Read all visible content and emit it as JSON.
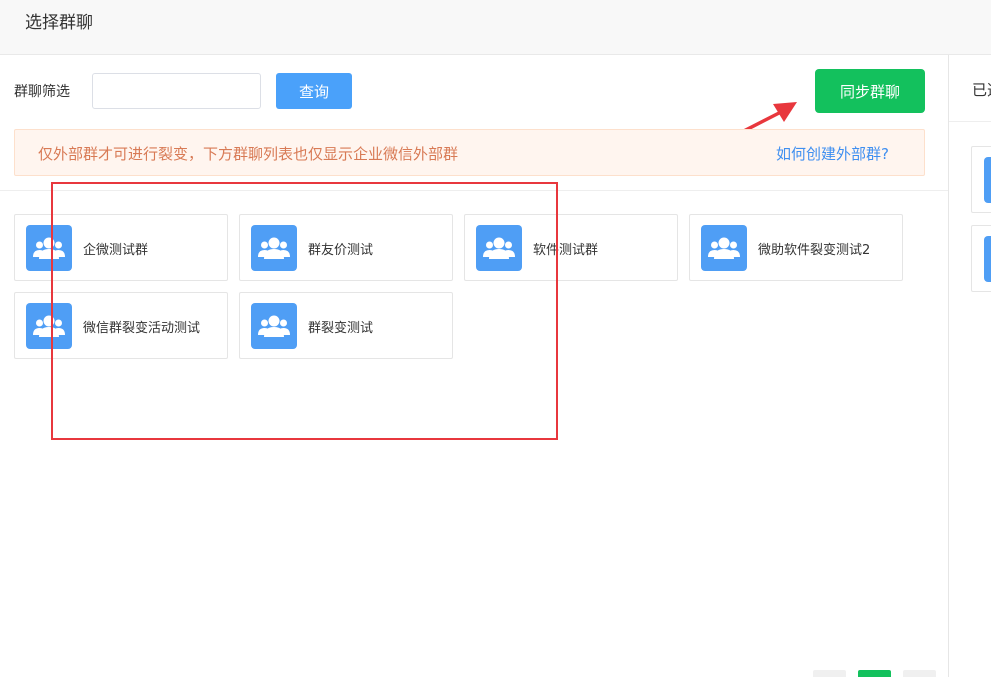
{
  "header": {
    "title": "选择群聊"
  },
  "filter": {
    "label": "群聊筛选",
    "input_value": "",
    "input_placeholder": "",
    "query_label": "查询",
    "sync_label": "同步群聊"
  },
  "notice": {
    "text": "仅外部群才可进行裂变，下方群聊列表也仅显示企业微信外部群",
    "link": "如何创建外部群?"
  },
  "groups": [
    {
      "name": "企微测试群"
    },
    {
      "name": "群友价测试"
    },
    {
      "name": "软件测试群"
    },
    {
      "name": "微助软件裂变测试2"
    },
    {
      "name": "微信群裂变活动测试"
    },
    {
      "name": "群裂变测试"
    }
  ],
  "selected_panel": {
    "title": "已选"
  },
  "colors": {
    "accent_blue": "#4aa1fa",
    "sync_green": "#13c15d",
    "notice_text": "#d87a55",
    "link_blue": "#3f8ff0",
    "annotation_red": "#e8373d"
  },
  "icons": {
    "group_avatar": "group-users-icon"
  }
}
